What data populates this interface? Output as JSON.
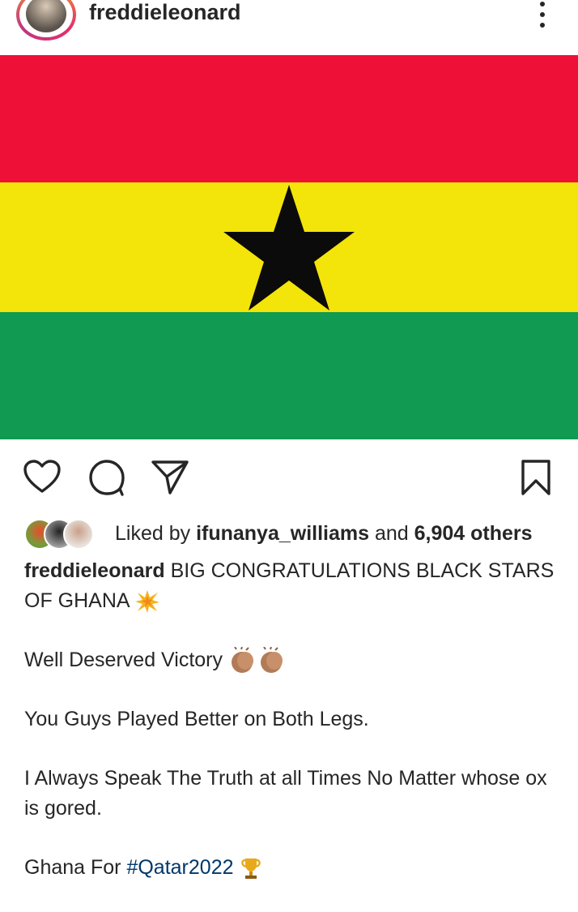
{
  "post": {
    "username": "freddieleonard",
    "likes": {
      "prefix": "Liked by ",
      "user": "ifunanya_williams",
      "middle": " and ",
      "count": "6,904 others"
    },
    "caption": {
      "username": "freddieleonard",
      "line1": " BIG CONGRATULATIONS BLACK STARS OF GHANA",
      "line2": "Well Deserved Victory",
      "line3": "You Guys Played Better on Both Legs.",
      "line4": "I Always Speak The Truth at all Times No Matter whose ox is gored.",
      "line5_prefix": "Ghana For ",
      "hashtag": "#Qatar2022"
    }
  },
  "icons": {
    "more": "more-vertical-icon",
    "like": "heart-icon",
    "comment": "comment-icon",
    "share": "send-icon",
    "save": "bookmark-icon",
    "burst": "sparkle-burst-emoji",
    "clap": "clapping-hands-emoji",
    "trophy": "trophy-emoji"
  },
  "colors": {
    "flag_red": "#ef1037",
    "flag_yellow": "#f3e40a",
    "flag_green": "#119a52",
    "star": "#0b0b0b",
    "text": "#262626",
    "hashtag": "#00376b"
  }
}
